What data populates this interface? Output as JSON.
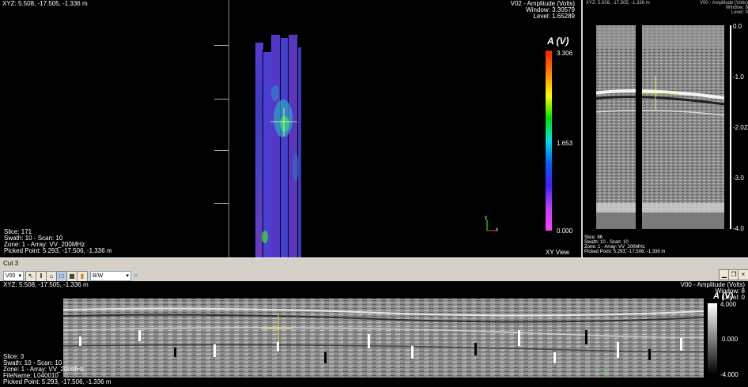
{
  "xy_view": {
    "coords": "XYZ: 5.508, -17.505, -1.336 m",
    "title": "V02 - Amplitude (Volts)",
    "window": "Window: 3.30579",
    "level": "Level: 1.65289",
    "legend_title": "A (V)",
    "legend_max": "3.306",
    "legend_mid": "1.653",
    "legend_min": "0.000",
    "view_label": "XY View",
    "info": [
      "Slice: 171",
      "Swath: 10 - Scan: 10",
      "Zone: 1 - Array: VV_200MHz",
      "Picked Point: 5.293, -17.506, -1.336 m"
    ],
    "axis_y": "y",
    "axis_x": "x"
  },
  "side_view": {
    "coords": "XYZ: 5.508, -17.505, -1.336 m",
    "title": "V00 - Amplitude (Volts)",
    "window": "Window: 8",
    "level": "Level: 0",
    "depth_ticks": [
      "0.0",
      "-1.0",
      "-2.0",
      "-3.0",
      "-4.0"
    ],
    "axis_z": "Z",
    "info": [
      "Slice: 86",
      "Swath: 10 - Scan: 10",
      "Zone: 1 - Array: VV_200MHz",
      "Picked Point: 5.293, -17.506, -1.336 m"
    ]
  },
  "toolbar": {
    "cut_label": "Cut 3",
    "channel_select": "V00",
    "color_select": "B/W"
  },
  "cut_view": {
    "coords": "XYZ: 5.508, -17.505, -1.336 m",
    "title": "V00 - Amplitude (Volts)",
    "window": "Window: 8",
    "level": "Level: 0",
    "legend_title": "A (V)",
    "legend_max": "4.000",
    "legend_mid": "0.000",
    "legend_min": "-4.000",
    "info": [
      "Slice: 3",
      "Swath: 10 - Scan: 10",
      "Zone: 1 - Array: VV_200MHz",
      "FileName: L040010",
      "Picked Point: 5.293, -17.506, -1.336 m"
    ]
  }
}
